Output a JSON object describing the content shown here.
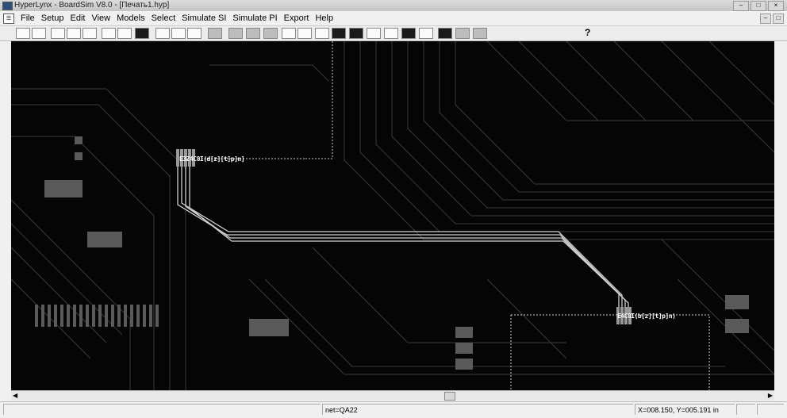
{
  "window": {
    "title": "HyperLynx - BoardSim V8.0 - [Печать1.hyp]"
  },
  "menu": [
    "File",
    "Setup",
    "Edit",
    "View",
    "Models",
    "Select",
    "Simulate SI",
    "Simulate PI",
    "Export",
    "Help"
  ],
  "toolbar": {
    "help_glyph": "?"
  },
  "canvas": {
    "ref_label_1": "E3Z4C8I(d[z][t]p]n]",
    "ref_label_2": "E4C8I(b[z][t]p]n)"
  },
  "status": {
    "net": "net=QA22",
    "coords": "X=008.150, Y=005.191 in"
  }
}
